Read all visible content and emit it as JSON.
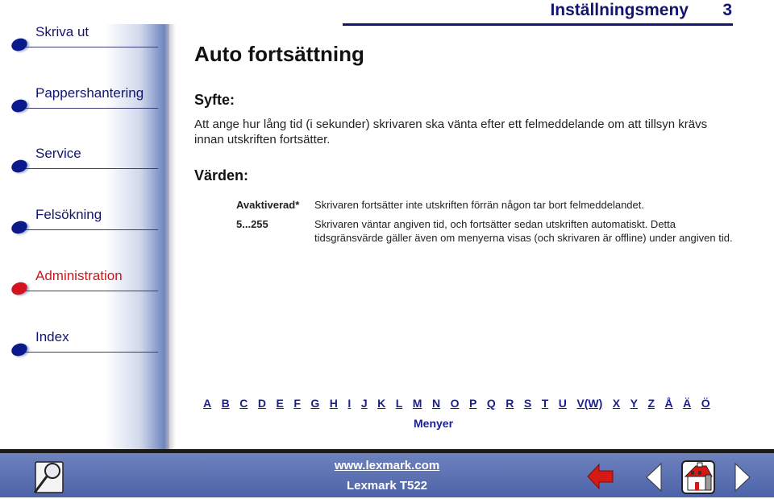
{
  "sidebar": {
    "items": [
      {
        "label": "Skriva ut",
        "active": false
      },
      {
        "label": "Pappershantering",
        "active": false
      },
      {
        "label": "Service",
        "active": false
      },
      {
        "label": "Felsökning",
        "active": false
      },
      {
        "label": "Administration",
        "active": true
      },
      {
        "label": "Index",
        "active": false
      }
    ]
  },
  "header": {
    "section": "Inställningsmeny",
    "page_number": "3"
  },
  "content": {
    "title": "Auto fortsättning",
    "purpose_heading": "Syfte:",
    "purpose_text": "Att ange hur lång tid (i sekunder) skrivaren ska vänta efter ett felmeddelande om att tillsyn krävs innan utskriften fortsätter.",
    "values_heading": "Värden:",
    "values": [
      {
        "key": "Avaktiverad*",
        "description": "Skrivaren fortsätter inte utskriften förrän någon tar bort felmeddelandet."
      },
      {
        "key": "5...255",
        "description": "Skrivaren väntar angiven tid, och fortsätter sedan utskriften automatiskt. Detta tidsgränsvärde gäller även om menyerna visas (och skrivaren är offline) under angiven tid."
      }
    ]
  },
  "alphabet_index": [
    "A",
    "B",
    "C",
    "D",
    "E",
    "F",
    "G",
    "H",
    "I",
    "J",
    "K",
    "L",
    "M",
    "N",
    "O",
    "P",
    "Q",
    "R",
    "S",
    "T",
    "U",
    "V(W)",
    "X",
    "Y",
    "Z",
    "Å",
    "Ä",
    "Ö"
  ],
  "menus_link": "Menyer",
  "footer": {
    "url": "www.lexmark.com",
    "model": "Lexmark T522",
    "icons": [
      "search-icon",
      "back-arrow-icon",
      "previous-page-icon",
      "home-icon",
      "next-page-icon"
    ]
  },
  "colors": {
    "nav_text": "#12156e",
    "active": "#c51a22",
    "footer_bg": "#5a70b0"
  }
}
